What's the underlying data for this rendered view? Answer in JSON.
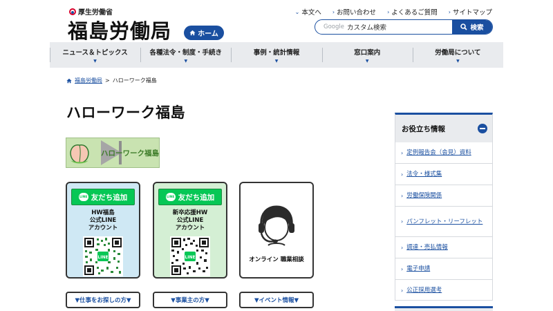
{
  "header": {
    "ministry": "厚生労働省",
    "bureau": "福島労働局",
    "home_label": "ホーム",
    "top_links": [
      "本文へ",
      "お問い合わせ",
      "よくあるご質問",
      "サイトマップ"
    ],
    "search_brand": "Google",
    "search_placeholder": "カスタム検索",
    "search_button": "検索"
  },
  "nav": [
    "ニュース＆トピックス",
    "各種法令・制度・手続き",
    "事例・統計情報",
    "窓口案内",
    "労働局について"
  ],
  "breadcrumb": {
    "home": "福島労働局",
    "separator": ">",
    "current": "ハローワーク福島"
  },
  "page_title": "ハローワーク福島",
  "banner_text": "ハローワーク福島",
  "cards": [
    {
      "button": "友だち追加",
      "text": [
        "HW福島",
        "公式LINE",
        "アカウント"
      ]
    },
    {
      "button": "友だち追加",
      "text": [
        "新卒応援HW",
        "公式LINE",
        "アカウント"
      ]
    },
    {
      "label": "オンライン 職業相談"
    }
  ],
  "line_logo_text": "LINE",
  "pills": [
    "▼仕事をお探しの方▼",
    "▼事業主の方▼",
    "▼イベント情報▼"
  ],
  "sidebar": {
    "title": "お役立ち情報",
    "items": [
      "定例報告会（会見）資料",
      "法令・様式集",
      "労働保険関係",
      "パンフレット・リーフレット",
      "調達・売払情報",
      "電子申請",
      "公正採用選考"
    ]
  },
  "colors": {
    "primary": "#1a4fa0",
    "line_green": "#06c755",
    "nav_bg": "#e9ebee",
    "card1_bg": "#cfe8f4",
    "card2_bg": "#d4efd4"
  }
}
